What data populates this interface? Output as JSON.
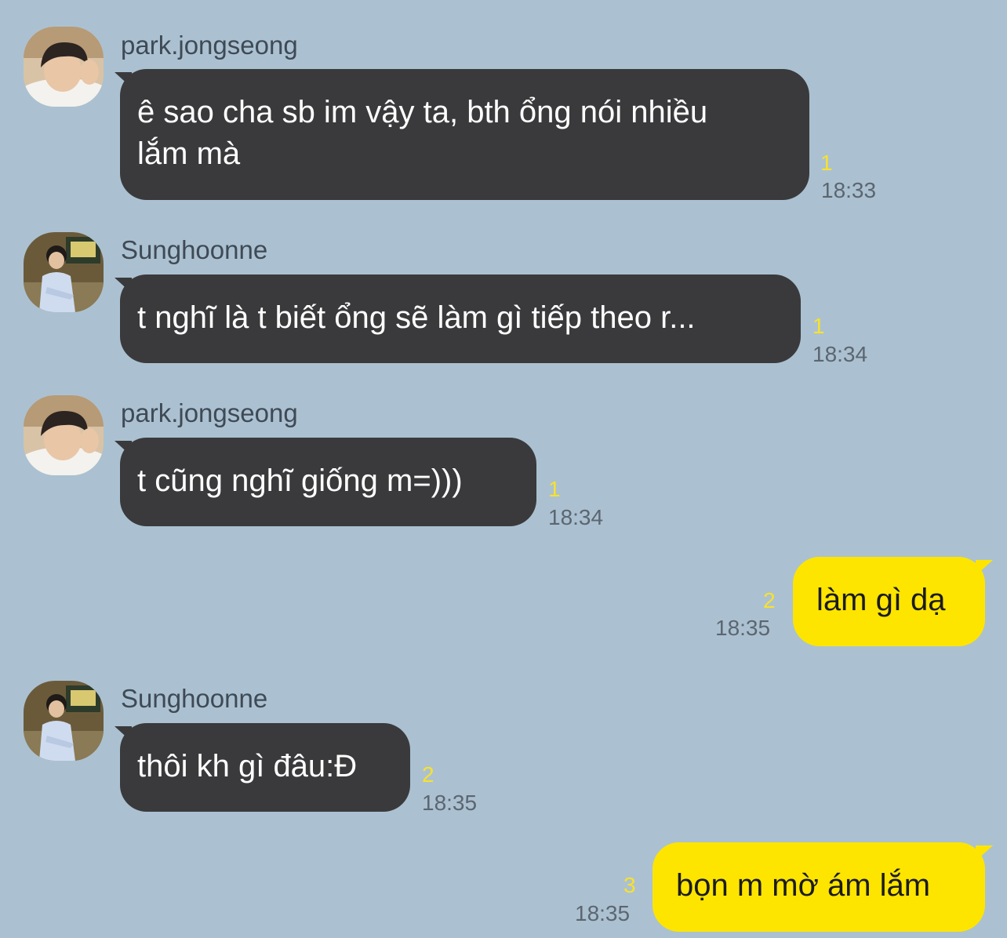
{
  "colors": {
    "background": "#abc1d1",
    "incoming_bubble": "#3a3a3c",
    "outgoing_bubble": "#fde500",
    "unread_count": "#f9e12c",
    "timestamp": "#5c6670"
  },
  "messages": [
    {
      "direction": "incoming",
      "sender": "park.jongseong",
      "avatar": "profile-photo-park-jongseong",
      "line1": "ê sao cha sb im vậy ta, bth ổng nói nhiều",
      "line2": "lắm mà",
      "unread": "1",
      "time": "18:33"
    },
    {
      "direction": "incoming",
      "sender": "Sunghoonne",
      "avatar": "profile-photo-sunghoonne",
      "text": "t nghĩ là t biết ổng sẽ làm gì tiếp theo r...",
      "unread": "1",
      "time": "18:34"
    },
    {
      "direction": "incoming",
      "sender": "park.jongseong",
      "avatar": "profile-photo-park-jongseong",
      "text": "t cũng nghĩ giống m=)))",
      "unread": "1",
      "time": "18:34"
    },
    {
      "direction": "outgoing",
      "text": "làm gì dạ",
      "unread": "2",
      "time": "18:35"
    },
    {
      "direction": "incoming",
      "sender": "Sunghoonne",
      "avatar": "profile-photo-sunghoonne",
      "text": "thôi kh gì đâu:Đ",
      "unread": "2",
      "time": "18:35"
    },
    {
      "direction": "outgoing",
      "text": "bọn m mờ ám lắm",
      "unread": "3",
      "time": "18:35"
    }
  ]
}
